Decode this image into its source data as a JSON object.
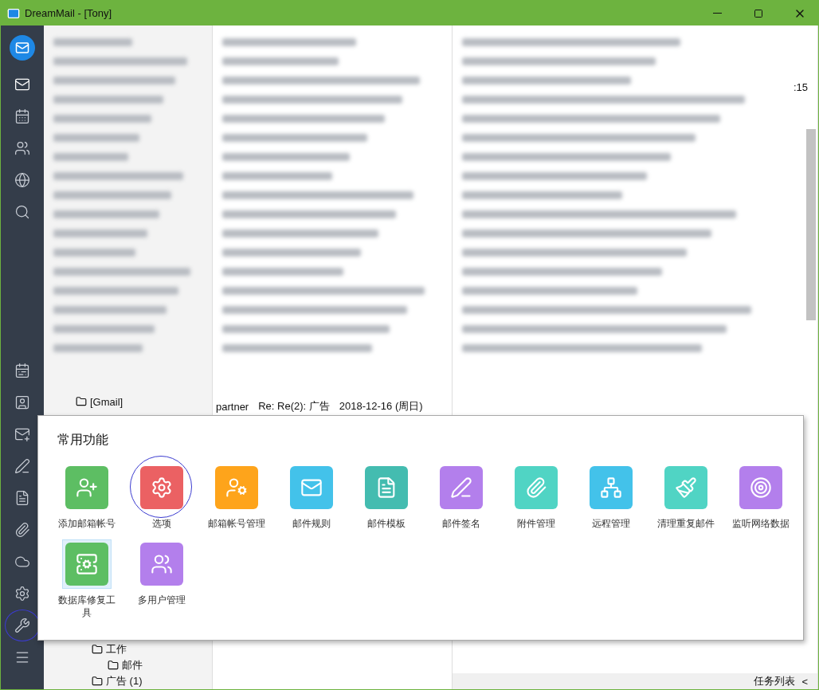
{
  "window": {
    "title": "DreamMail - [Tony]"
  },
  "sidebar": {
    "items": [
      {
        "highlighted": false
      },
      {
        "highlighted": false
      },
      {
        "highlighted": false
      },
      {
        "highlighted": false
      },
      {
        "highlighted": false
      },
      {
        "highlighted": false
      },
      {
        "highlighted": false
      },
      {
        "highlighted": false
      },
      {
        "highlighted": false
      },
      {
        "highlighted": false
      },
      {
        "highlighted": false
      },
      {
        "highlighted": false
      },
      {
        "highlighted": false
      },
      {
        "highlighted": true
      },
      {
        "highlighted": false
      }
    ]
  },
  "folder_tree": {
    "top_item": "[Gmail]",
    "bottom_items": [
      {
        "label": "工作",
        "children": [
          {
            "label": "邮件"
          }
        ]
      },
      {
        "label": "广告 (1)"
      }
    ]
  },
  "message_list": {
    "visible_row": {
      "sender": "partner",
      "subject": "Re: Re(2): 广告",
      "date": "2018-12-16 (周日)"
    }
  },
  "reading_pane": {
    "time_fragment": ":15"
  },
  "popup": {
    "title": "常用功能",
    "items": [
      {
        "label": "添加邮箱帐号",
        "color": "#5dbe63",
        "highlighted": false,
        "selected": false
      },
      {
        "label": "选项",
        "color": "#eb6163",
        "highlighted": true,
        "selected": false
      },
      {
        "label": "邮箱帐号管理",
        "color": "#fea41b",
        "highlighted": false,
        "selected": false
      },
      {
        "label": "邮件规则",
        "color": "#43c2ea",
        "highlighted": false,
        "selected": false
      },
      {
        "label": "邮件模板",
        "color": "#44bcb0",
        "highlighted": false,
        "selected": false
      },
      {
        "label": "邮件签名",
        "color": "#b37fec",
        "highlighted": false,
        "selected": false
      },
      {
        "label": "附件管理",
        "color": "#50d4c4",
        "highlighted": false,
        "selected": false
      },
      {
        "label": "远程管理",
        "color": "#43c2ea",
        "highlighted": false,
        "selected": false
      },
      {
        "label": "清理重复邮件",
        "color": "#50d4c4",
        "highlighted": false,
        "selected": false
      },
      {
        "label": "监听网络数据",
        "color": "#b37fec",
        "highlighted": false,
        "selected": false
      },
      {
        "label": "数据库修复工具",
        "color": "#5dbe63",
        "highlighted": false,
        "selected": true
      },
      {
        "label": "多用户管理",
        "color": "#b37fec",
        "highlighted": false,
        "selected": false
      }
    ]
  },
  "status_bar": {
    "label": "任务列表",
    "arrow": "<"
  }
}
